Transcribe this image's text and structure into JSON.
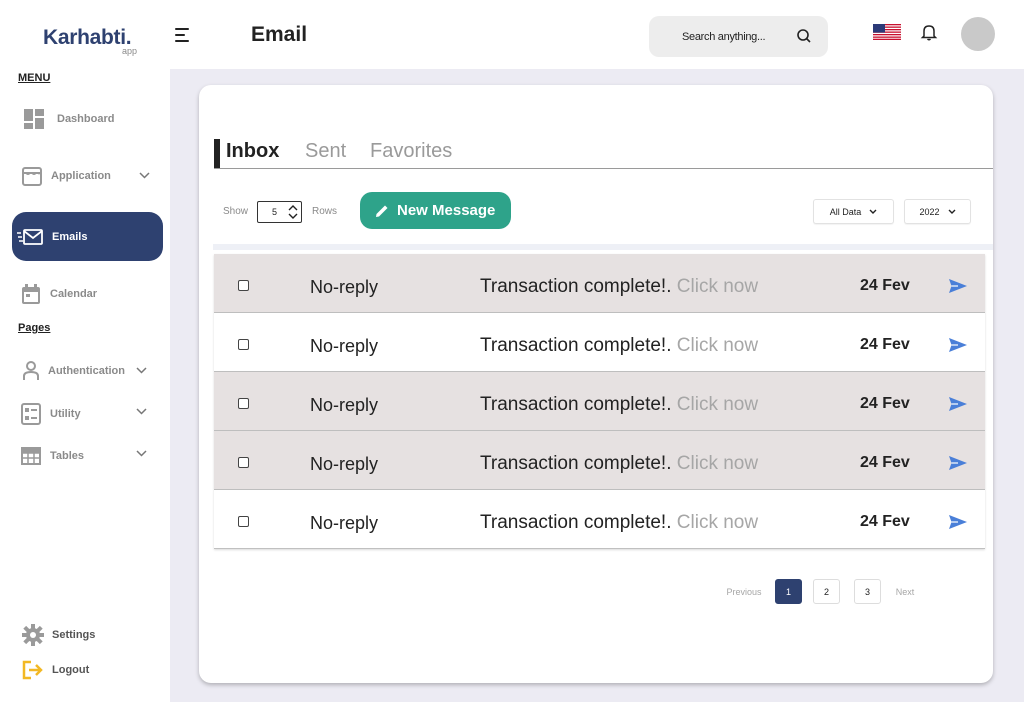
{
  "app": {
    "logo_main": "Karhabti",
    "logo_dot": ".",
    "logo_sub": "app"
  },
  "sidebar": {
    "menu_title": "MENU",
    "pages_title": "Pages",
    "items": {
      "dashboard": "Dashboard",
      "application": "Application",
      "emails": "Emails",
      "calendar": "Calendar",
      "authentication": "Authentication",
      "utility": "Utility",
      "tables": "Tables",
      "settings": "Settings",
      "logout": "Logout"
    }
  },
  "header": {
    "title": "Email",
    "search_placeholder": "Search anything..."
  },
  "tabs": {
    "inbox": "Inbox",
    "sent": "Sent",
    "favorites": "Favorites"
  },
  "toolbar": {
    "show_label": "Show",
    "rows_value": "5",
    "rows_label": "Rows",
    "new_message_label": "New Message",
    "filter_value": "All Data",
    "year_value": "2022"
  },
  "emails": [
    {
      "sender": "No-reply",
      "subject": "Transaction complete!.",
      "cta": "Click now",
      "date": "24 Fev"
    },
    {
      "sender": "No-reply",
      "subject": "Transaction complete!.",
      "cta": "Click now",
      "date": "24 Fev"
    },
    {
      "sender": "No-reply",
      "subject": "Transaction complete!.",
      "cta": "Click now",
      "date": "24 Fev"
    },
    {
      "sender": "No-reply",
      "subject": "Transaction complete!.",
      "cta": "Click now",
      "date": "24 Fev"
    },
    {
      "sender": "No-reply",
      "subject": "Transaction complete!.",
      "cta": "Click now",
      "date": "24 Fev"
    }
  ],
  "pagination": {
    "previous": "Previous",
    "pages": [
      "1",
      "2",
      "3"
    ],
    "current": "1",
    "next": "Next"
  },
  "colors": {
    "brand": "#2E4170",
    "accent_green": "#2EA38A",
    "send_icon": "#4A7FD8",
    "row_shade": "#E6E1E1",
    "background": "#ECEBF3"
  },
  "icons": {
    "dashboard": "grid-icon",
    "application": "store-icon",
    "emails": "mail-icon",
    "calendar": "calendar-icon",
    "authentication": "user-icon",
    "utility": "list-icon",
    "tables": "table-icon",
    "settings": "gear-icon",
    "logout": "logout-icon",
    "search": "search-icon",
    "notifications": "bell-icon",
    "language": "us-flag-icon",
    "send": "send-icon",
    "new_message": "pencil-icon"
  }
}
